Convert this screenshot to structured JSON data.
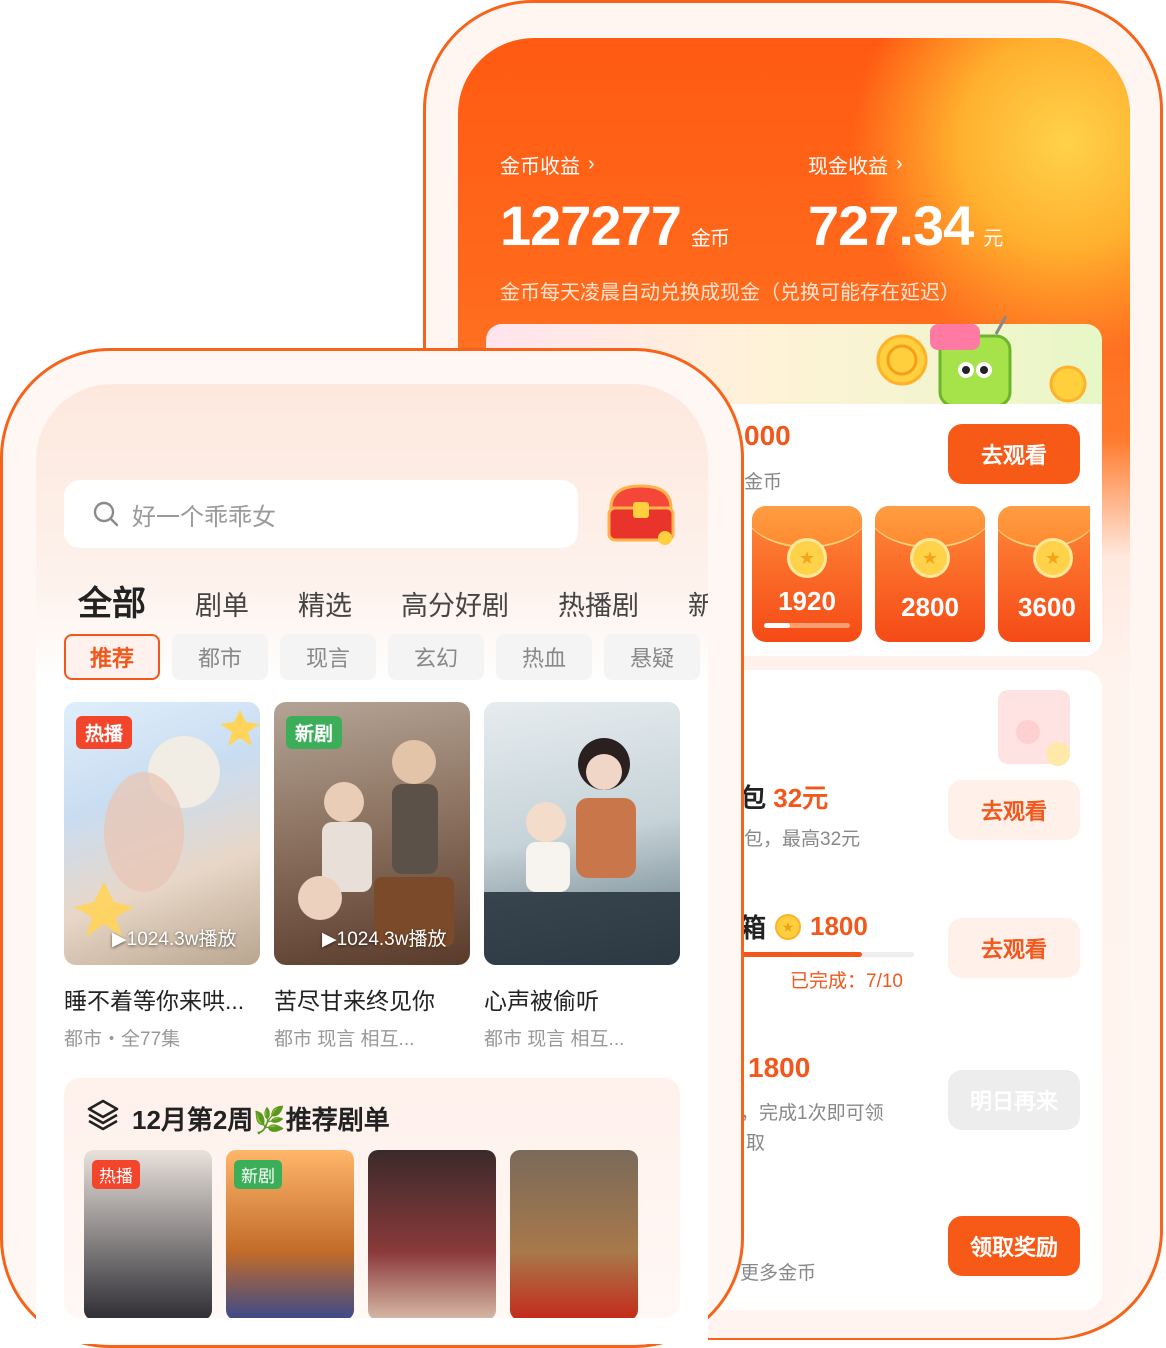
{
  "earnings": {
    "coin_label": "金币收益",
    "coin_value": "127277",
    "coin_unit": "金币",
    "cash_label": "现金收益",
    "cash_value": "727.34",
    "cash_unit": "元",
    "note": "金币每天凌晨自动兑换成现金（兑换可能存在延迟）"
  },
  "task_card": {
    "partial_title": "000",
    "partial_sub": "金币",
    "watch_button": "去观看",
    "packets": [
      {
        "amount": "1920",
        "progress": 0.3
      },
      {
        "amount": "2800",
        "progress": 0
      },
      {
        "amount": "3600",
        "progress": 0
      }
    ]
  },
  "tasks": [
    {
      "partial_title_prefix": "包",
      "title_value": "32元",
      "sub": "包，最高32元",
      "button": "去观看"
    },
    {
      "partial_title_prefix": "箱",
      "title_value": "1800",
      "progress_text": "已完成：7/10",
      "progress": 0.7,
      "button": "去观看"
    },
    {
      "title_value": "1800",
      "sub_line1": "，完成1次即可领",
      "sub_line2": "取",
      "button": "明日再来"
    },
    {
      "sub": "更多金币",
      "button": "领取奖励"
    }
  ],
  "front": {
    "search_placeholder": "好一个乖乖女",
    "tabs": [
      "全部",
      "剧单",
      "精选",
      "高分好剧",
      "热播剧",
      "新"
    ],
    "chips": [
      "推荐",
      "都市",
      "现言",
      "玄幻",
      "热血",
      "悬疑"
    ],
    "posters": [
      {
        "tag": "热播",
        "plays": "1024.3w播放",
        "title": "睡不着等你来哄...",
        "meta": "都市・全77集"
      },
      {
        "tag": "新剧",
        "plays": "1024.3w播放",
        "title": "苦尽甘来终见你",
        "meta": "都市  现言  相互..."
      },
      {
        "tag": "",
        "plays": "",
        "title": "心声被偷听",
        "meta": "都市  现言  相互..."
      }
    ],
    "playlist": {
      "title": "12月第2周🌿推荐剧单",
      "items": [
        {
          "tag": "热播"
        },
        {
          "tag": "新剧"
        },
        {
          "tag": ""
        },
        {
          "tag": ""
        }
      ]
    }
  },
  "colors": {
    "accent": "#f75a16",
    "hot_tag": "#f2452c",
    "new_tag": "#3cae5a"
  }
}
